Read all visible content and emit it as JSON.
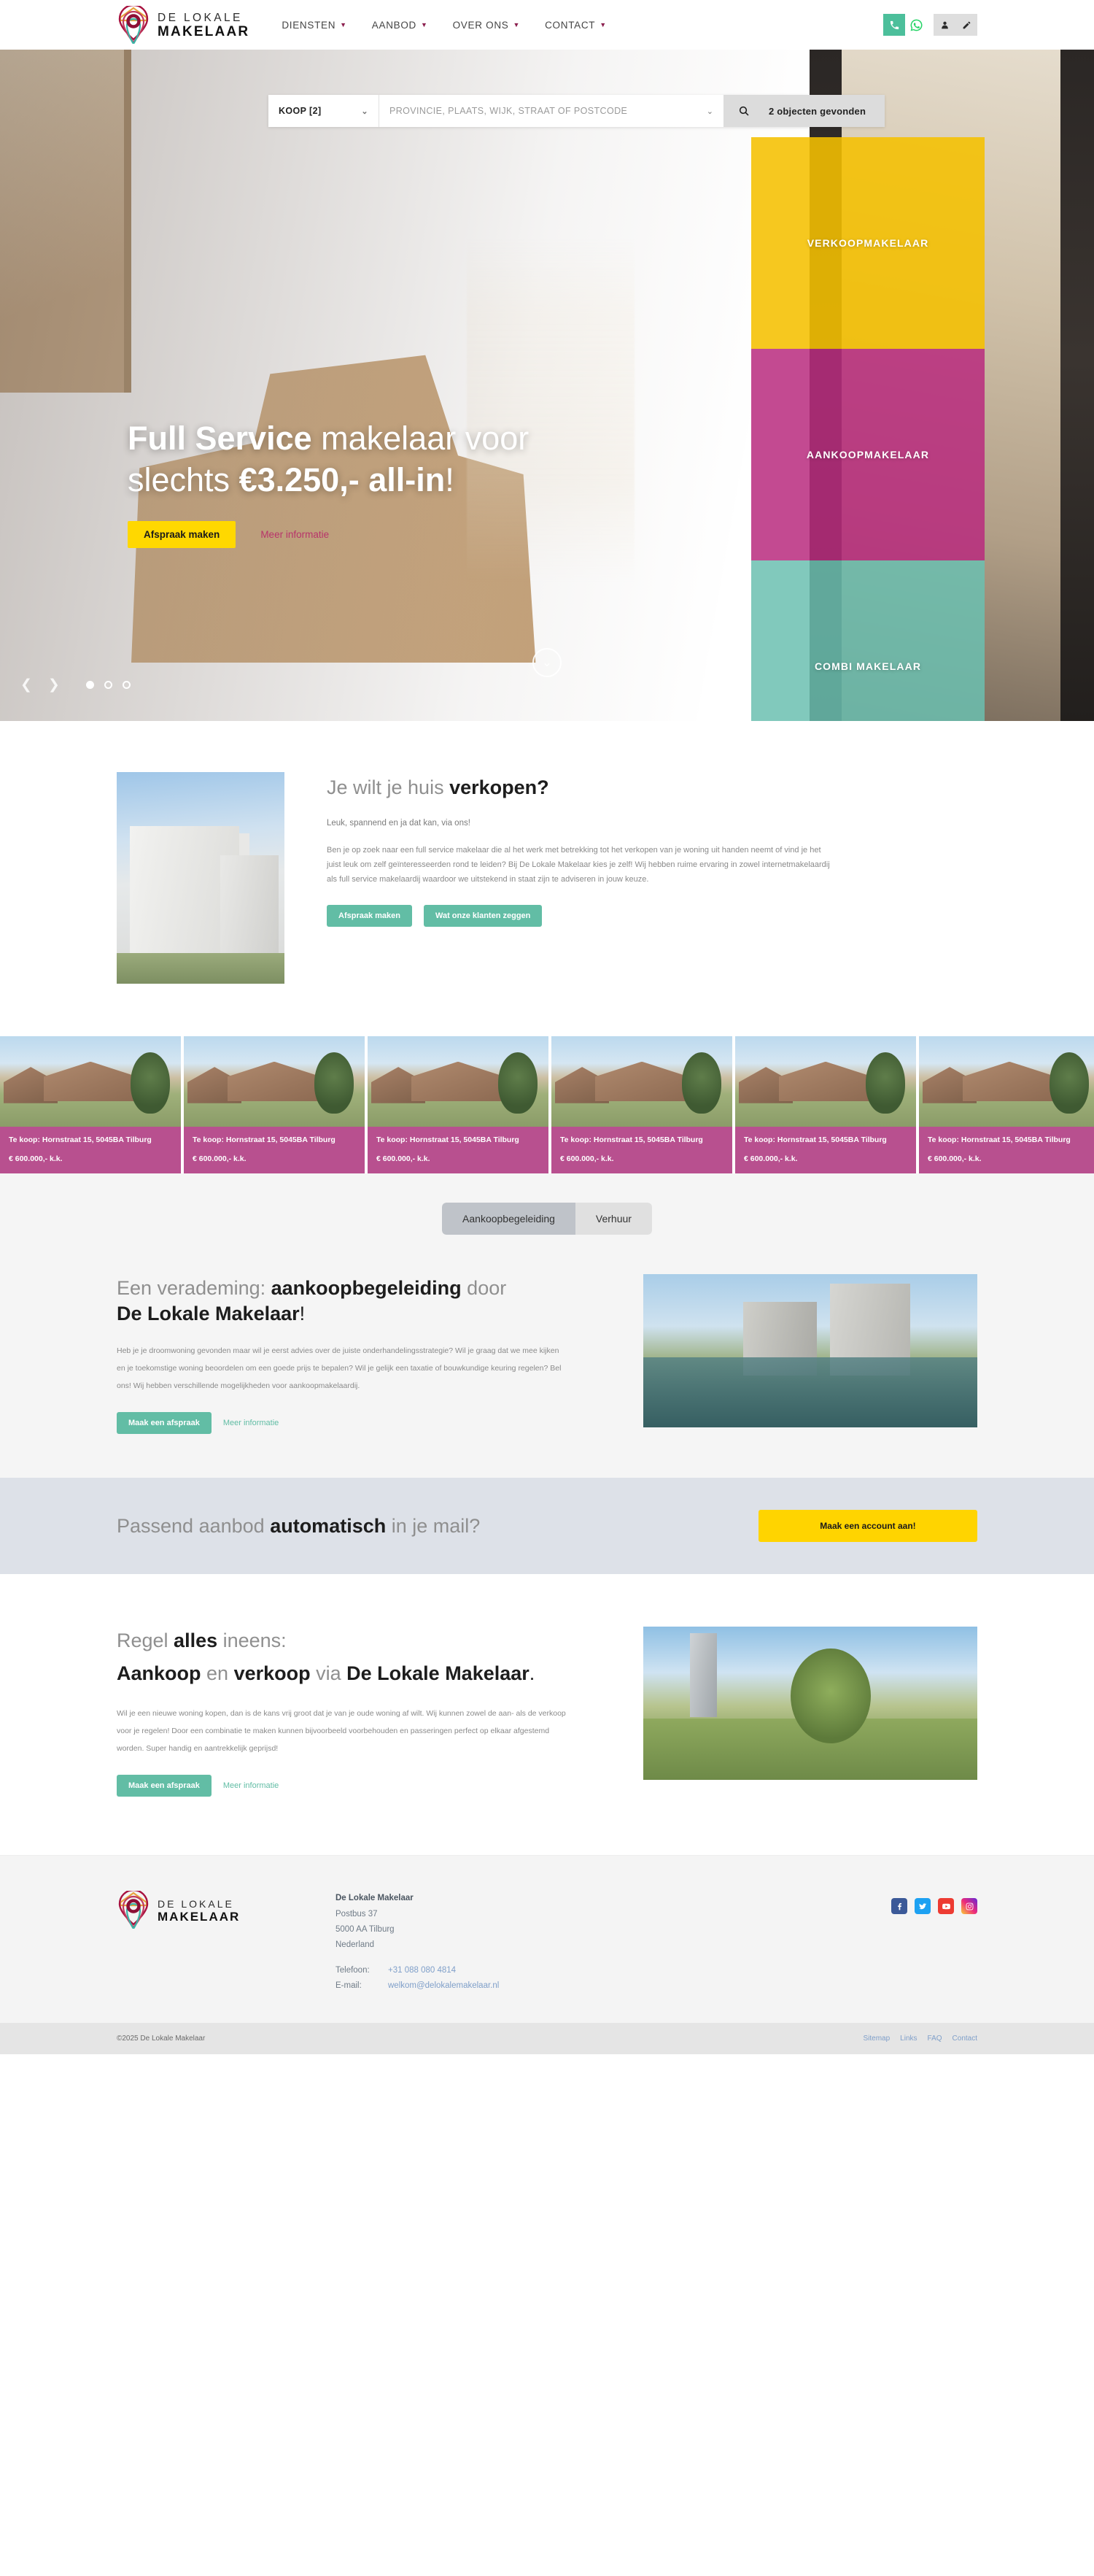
{
  "header": {
    "logo": {
      "line1": "DE LOKALE",
      "line2": "MAKELAAR"
    },
    "nav": [
      {
        "label": "DIENSTEN",
        "caret": "chevron-down-icon"
      },
      {
        "label": "AANBOD",
        "caret": "chevron-down-icon"
      },
      {
        "label": "OVER ONS",
        "caret": "chevron-down-icon"
      },
      {
        "label": "CONTACT",
        "caret": "chevron-down-icon"
      }
    ],
    "actions": [
      {
        "name": "phone-icon",
        "color": "#4cbf9b"
      },
      {
        "name": "whatsapp-icon",
        "color": "#25d366"
      },
      {
        "name": "user-icon",
        "color": "#333333"
      },
      {
        "name": "pen-icon",
        "color": "#333333"
      }
    ]
  },
  "search": {
    "type_value": "KOOP [2]",
    "placeholder": "PROVINCIE, PLAATS, WIJK, STRAAT OF POSTCODE",
    "input_value": "",
    "results_label": "2 objecten gevonden",
    "search_icon": "search-icon"
  },
  "hero": {
    "title_part1": "Full Service",
    "title_part2": " makelaar voor",
    "title_part3": "slechts ",
    "title_part4": "€3.250,- all-in",
    "title_part5": "!",
    "cta_button": "Afspraak maken",
    "cta_link": "Meer informatie",
    "panels": [
      {
        "label": "VERKOOPMAKELAAR",
        "color": "#F5C000"
      },
      {
        "label": "AANKOOPMAKELAAR",
        "color": "#B82A7E"
      },
      {
        "label": "COMBI MAKELAAR",
        "color": "#6BBFB0"
      }
    ],
    "carousel": {
      "prev": "chevron-left-icon",
      "next": "chevron-right-icon",
      "slides": 3,
      "active_slide": 1,
      "scroll_down": "chevron-down-icon"
    }
  },
  "sell": {
    "title_light": "Je wilt je huis ",
    "title_bold": "verkopen?",
    "lead": "Leuk, spannend en ja dat kan, via ons!",
    "body": "Ben je op zoek naar een full service makelaar die al het werk met betrekking tot het verkopen van je woning uit handen neemt of vind je het juist leuk om zelf geïnteresseerden rond te leiden? Bij De Lokale Makelaar kies je zelf! Wij hebben ruime ervaring in zowel internetmakelaardij als full service makelaardij waardoor we uitstekend in staat zijn te adviseren in jouw keuze.",
    "btn_primary": "Afspraak maken",
    "btn_secondary": "Wat onze klanten zeggen"
  },
  "listings": [
    {
      "title": "Te koop: Hornstraat 15, 5045BA Tilburg",
      "price": "€ 600.000,- k.k."
    },
    {
      "title": "Te koop: Hornstraat 15, 5045BA Tilburg",
      "price": "€ 600.000,- k.k."
    },
    {
      "title": "Te koop: Hornstraat 15, 5045BA Tilburg",
      "price": "€ 600.000,- k.k."
    },
    {
      "title": "Te koop: Hornstraat 15, 5045BA Tilburg",
      "price": "€ 600.000,- k.k."
    },
    {
      "title": "Te koop: Hornstraat 15, 5045BA Tilburg",
      "price": "€ 600.000,- k.k."
    },
    {
      "title": "Te koop: Hornstraat 15, 5045BA Tilburg",
      "price": "€ 600.000,- k.k."
    }
  ],
  "tabs": {
    "items": [
      {
        "label": "Aankoopbegeleiding",
        "active": true
      },
      {
        "label": "Verhuur",
        "active": false
      }
    ]
  },
  "guidance": {
    "title_light1": "Een verademing: ",
    "title_bold1": "aankoopbegeleiding",
    "title_light2": " door",
    "title_bold2": "De Lokale Makelaar",
    "title_tail": "!",
    "body": "Heb je je droomwoning gevonden maar wil je eerst advies over de juiste onderhandelingsstrategie? Wil je graag dat we mee kijken en je toekomstige woning beoordelen om een goede prijs te bepalen? Wil je gelijk een taxatie of bouwkundige keuring regelen? Bel ons! Wij hebben verschillende mogelijkheden voor aankoopmakelaardij.",
    "btn_primary": "Maak een afspraak",
    "btn_link": "Meer informatie"
  },
  "mailcta": {
    "title_light1": "Passend aanbod ",
    "title_bold": "automatisch",
    "title_light2": " in je mail?",
    "button": "Maak een account aan!"
  },
  "combi": {
    "title_light1": "Regel ",
    "title_bold1": "alles",
    "title_light2": " ineens:",
    "line2_bold1": "Aankoop",
    "line2_light1": " en ",
    "line2_bold2": "verkoop",
    "line2_light2": " via ",
    "line2_bold3": "De Lokale Makelaar",
    "line2_tail": ".",
    "body": "Wil je een nieuwe woning kopen, dan is de kans vrij groot dat je van je oude woning af wilt. Wij kunnen zowel de aan- als de verkoop voor je regelen! Door een combinatie te maken kunnen bijvoorbeeld voorbehouden en passeringen perfect op elkaar afgestemd worden. Super handig en aantrekkelijk geprijsd!",
    "btn_primary": "Maak een afspraak",
    "btn_link": "Meer informatie"
  },
  "footer": {
    "logo": {
      "line1": "DE LOKALE",
      "line2": "MAKELAAR"
    },
    "company": "De Lokale Makelaar",
    "address_line1": "Postbus 37",
    "address_line2": "5000 AA Tilburg",
    "address_line3": "Nederland",
    "phone_label": "Telefoon:",
    "phone_value": "+31 088 080 4814",
    "email_label": "E-mail:",
    "email_value": "welkom@delokalemakelaar.nl",
    "socials": [
      {
        "name": "facebook-icon",
        "color": "#3b5998"
      },
      {
        "name": "twitter-icon",
        "color": "#1da1f2"
      },
      {
        "name": "youtube-icon",
        "color": "#ed3b32"
      },
      {
        "name": "instagram-icon",
        "color": "#ee2a7b"
      }
    ],
    "copyright": "©2025 De Lokale Makelaar",
    "links": [
      "Sitemap",
      "Links",
      "FAQ",
      "Contact"
    ]
  }
}
